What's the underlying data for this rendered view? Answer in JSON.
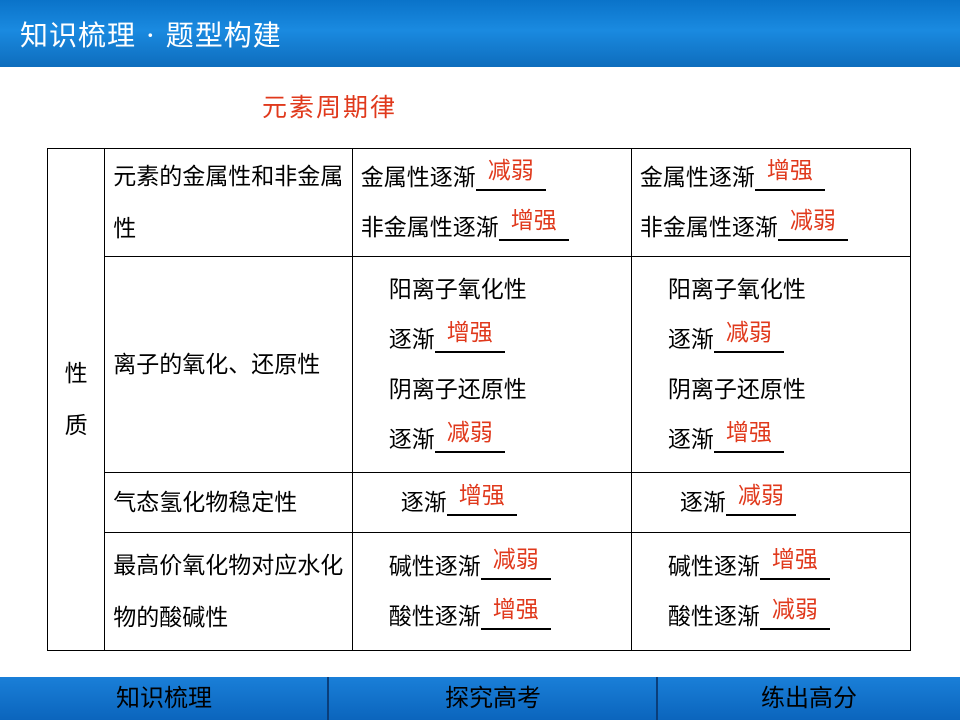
{
  "header": {
    "title": "知识梳理 · 题型构建"
  },
  "heading": "元素周期律",
  "table": {
    "property_label": [
      "性",
      "质"
    ],
    "rows": [
      {
        "aspect": "元素的金属性和非金属性",
        "col1": [
          {
            "prefix": "金属性逐渐",
            "answer": "减弱"
          },
          {
            "prefix": "非金属性逐渐",
            "answer": "增强"
          }
        ],
        "col2": [
          {
            "prefix": "金属性逐渐",
            "answer": "增强"
          },
          {
            "prefix": "非金属性逐渐",
            "answer": "减弱"
          }
        ]
      },
      {
        "aspect": "离子的氧化、还原性",
        "col1": [
          {
            "text": "阳离子氧化性"
          },
          {
            "prefix": "逐渐",
            "answer": "增强"
          },
          {
            "text": "阴离子还原性"
          },
          {
            "prefix": "逐渐",
            "answer": "减弱"
          }
        ],
        "col2": [
          {
            "text": "阳离子氧化性"
          },
          {
            "prefix": "逐渐",
            "answer": "减弱"
          },
          {
            "text": "阴离子还原性"
          },
          {
            "prefix": "逐渐",
            "answer": "增强"
          }
        ]
      },
      {
        "aspect": "气态氢化物稳定性",
        "col1": [
          {
            "prefix": "逐渐",
            "answer": "增强"
          }
        ],
        "col2": [
          {
            "prefix": "逐渐",
            "answer": "减弱"
          }
        ]
      },
      {
        "aspect": "最高价氧化物对应水化物的酸碱性",
        "col1": [
          {
            "prefix": "碱性逐渐",
            "answer": "减弱"
          },
          {
            "prefix": "酸性逐渐",
            "answer": "增强"
          }
        ],
        "col2": [
          {
            "prefix": "碱性逐渐",
            "answer": "增强"
          },
          {
            "prefix": "酸性逐渐",
            "answer": "减弱"
          }
        ]
      }
    ]
  },
  "footer": {
    "tabs": [
      "知识梳理",
      "探究高考",
      "练出高分"
    ]
  },
  "colors": {
    "accent_red": "#e0391c",
    "bar_blue": "#1a7fd8"
  }
}
